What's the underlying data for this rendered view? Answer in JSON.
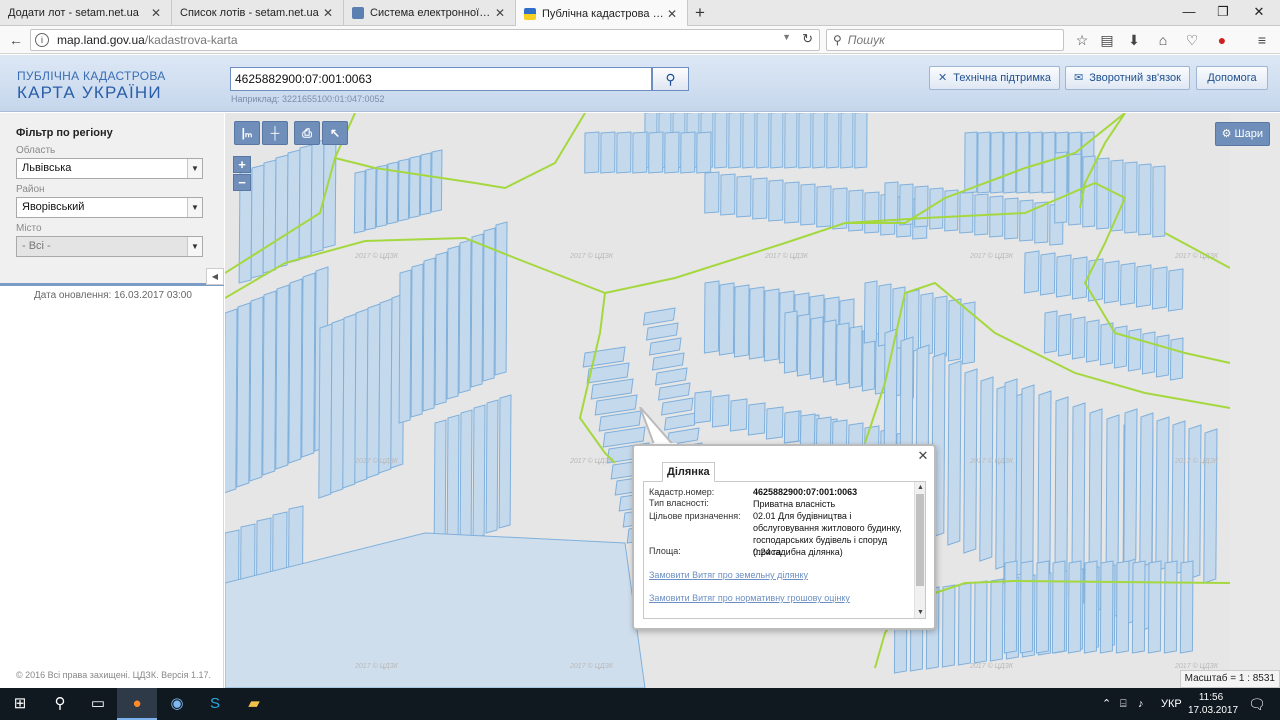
{
  "browser": {
    "tabs": [
      {
        "title": "Додати лот - setam.net.ua",
        "active": false
      },
      {
        "title": "Список лотів - setam.net.ua",
        "active": false
      },
      {
        "title": "Система електронної по...",
        "active": false
      },
      {
        "title": "Публічна кадастрова кар...",
        "active": true
      }
    ],
    "url_host": "map.land.gov.ua",
    "url_path": "/kadastrova-karta",
    "search_placeholder": "Пошук"
  },
  "header": {
    "logo_line1": "ПУБЛІЧНА КАДАСТРОВА",
    "logo_line2": "КАРТА УКРАЇНИ",
    "search_value": "4625882900:07:001:0063",
    "search_example": "Наприклад: 3221655100:01:047:0052",
    "buttons": {
      "support": "Технічна підтримка",
      "feedback": "Зворотний зв'язок",
      "help": "Допомога"
    }
  },
  "filter": {
    "title": "Фільтр по регіону",
    "oblast_label": "Область",
    "oblast_value": "Львівська",
    "raion_label": "Район",
    "raion_value": "Яворівський",
    "misto_label": "Місто",
    "misto_value": "- Всі -",
    "update_date": "Дата оновлення: 16.03.2017 03:00",
    "copyright": "© 2016 Всі права захищені. ЦДЗК. Версія 1.17."
  },
  "map": {
    "layers_label": "Шари",
    "scale_text": "Масштаб = 1 : 8531",
    "watermark": "2017 © ЦДЗК",
    "toolbar": [
      "ruler-m-icon",
      "area-m2-icon",
      "print-icon",
      "query-cursor-icon"
    ],
    "colors": {
      "parcel_fill": "#c5d9ec",
      "parcel_stroke": "#7fb0dc",
      "boundary": "#a4d83e",
      "background": "#e6e6e6"
    }
  },
  "popup": {
    "tab_label": "Ділянка",
    "fields": [
      {
        "label": "Кадастр.номер:",
        "value": "4625882900:07:001:0063"
      },
      {
        "label": "Тип власності:",
        "value": "Приватна власність"
      },
      {
        "label": "Цільове призначення:",
        "value": "02.01 Для будівництва і обслуговування житлового будинку, господарських будівель і споруд (присадибна ділянка)"
      },
      {
        "label": "Площа:",
        "value": "0.24 га"
      }
    ],
    "link1": "Замовити Витяг про земельну ділянку",
    "link2": "Замовити Витяг про нормативну грошову оцінку"
  },
  "taskbar": {
    "language": "УКР",
    "time": "11:56",
    "date": "17.03.2017"
  }
}
